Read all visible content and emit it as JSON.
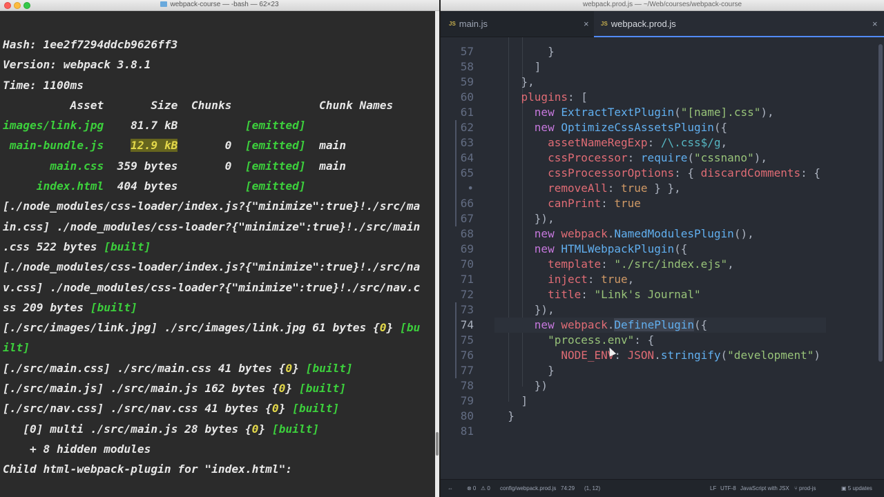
{
  "terminal": {
    "title": "webpack-course — -bash — 62×23",
    "lines": [
      [
        {
          "t": "Hash: 1ee2f7294ddcb9626ff3"
        }
      ],
      [
        {
          "t": "Version: webpack 3.8.1"
        }
      ],
      [
        {
          "t": "Time: 1100ms"
        }
      ],
      [
        {
          "t": "          Asset       Size  Chunks             Chunk Names"
        }
      ],
      [
        {
          "t": "images/link.jpg",
          "c": "g"
        },
        {
          "t": "    81.7 kB          "
        },
        {
          "t": "[emitted]",
          "c": "g"
        }
      ],
      [
        {
          "t": " main-bundle.js",
          "c": "g"
        },
        {
          "t": "    "
        },
        {
          "t": "12.9 kB",
          "c": "hl"
        },
        {
          "t": "       0  "
        },
        {
          "t": "[emitted]",
          "c": "g"
        },
        {
          "t": "  main"
        }
      ],
      [
        {
          "t": "       main.css",
          "c": "g"
        },
        {
          "t": "  359 bytes       0  "
        },
        {
          "t": "[emitted]",
          "c": "g"
        },
        {
          "t": "  main"
        }
      ],
      [
        {
          "t": "     index.html",
          "c": "g"
        },
        {
          "t": "  404 bytes          "
        },
        {
          "t": "[emitted]",
          "c": "g"
        }
      ],
      [
        {
          "t": "[./node_modules/css-loader/index.js?{\"minimize\":true}!./src/ma"
        }
      ],
      [
        {
          "t": "in.css] ./node_modules/css-loader?{\"minimize\":true}!./src/main"
        }
      ],
      [
        {
          "t": ".css 522 bytes "
        },
        {
          "t": "[built]",
          "c": "g"
        }
      ],
      [
        {
          "t": "[./node_modules/css-loader/index.js?{\"minimize\":true}!./src/na"
        }
      ],
      [
        {
          "t": "v.css] ./node_modules/css-loader?{\"minimize\":true}!./src/nav.c"
        }
      ],
      [
        {
          "t": "ss 209 bytes "
        },
        {
          "t": "[built]",
          "c": "g"
        }
      ],
      [
        {
          "t": "[./src/images/link.jpg] ./src/images/link.jpg 61 bytes {"
        },
        {
          "t": "0",
          "c": "y"
        },
        {
          "t": "} "
        },
        {
          "t": "[bu",
          "c": "g"
        }
      ],
      [
        {
          "t": "ilt]",
          "c": "g"
        }
      ],
      [
        {
          "t": "[./src/main.css] ./src/main.css 41 bytes {"
        },
        {
          "t": "0",
          "c": "y"
        },
        {
          "t": "} "
        },
        {
          "t": "[built]",
          "c": "g"
        }
      ],
      [
        {
          "t": "[./src/main.js] ./src/main.js 162 bytes {"
        },
        {
          "t": "0",
          "c": "y"
        },
        {
          "t": "} "
        },
        {
          "t": "[built]",
          "c": "g"
        }
      ],
      [
        {
          "t": "[./src/nav.css] ./src/nav.css 41 bytes {"
        },
        {
          "t": "0",
          "c": "y"
        },
        {
          "t": "} "
        },
        {
          "t": "[built]",
          "c": "g"
        }
      ],
      [
        {
          "t": "   [0] multi ./src/main.js 28 bytes {"
        },
        {
          "t": "0",
          "c": "y"
        },
        {
          "t": "} "
        },
        {
          "t": "[built]",
          "c": "g"
        }
      ],
      [
        {
          "t": "    + 8 hidden modules"
        }
      ],
      [
        {
          "t": "Child html-webpack-plugin for \"index.html\":"
        }
      ]
    ]
  },
  "editor": {
    "title": "webpack.prod.js — ~/Web/courses/webpack-course",
    "tabs": [
      {
        "label": "main.js",
        "badge": "JS",
        "close": "×"
      },
      {
        "label": "webpack.prod.js",
        "badge": "JS",
        "close": "×",
        "active": true
      }
    ],
    "line_numbers": [
      "57",
      "58",
      "59",
      "60",
      "61",
      "62",
      "63",
      "64",
      "65",
      "•",
      "66",
      "67",
      "68",
      "69",
      "70",
      "71",
      "72",
      "73",
      "74",
      "75",
      "76",
      "77",
      "78",
      "79",
      "80",
      "81"
    ],
    "code_lines": [
      [
        {
          "t": "        }"
        }
      ],
      [
        {
          "t": "      ]"
        }
      ],
      [
        {
          "t": "    },"
        }
      ],
      [
        {
          "t": "    "
        },
        {
          "t": "plugins",
          "c": "p"
        },
        {
          "t": ": ["
        }
      ],
      [
        {
          "t": "      "
        },
        {
          "t": "new",
          "c": "k"
        },
        {
          "t": " "
        },
        {
          "t": "ExtractTextPlugin",
          "c": "f"
        },
        {
          "t": "("
        },
        {
          "t": "\"[name].css\"",
          "c": "s"
        },
        {
          "t": "),"
        }
      ],
      [
        {
          "t": "      "
        },
        {
          "t": "new",
          "c": "k"
        },
        {
          "t": " "
        },
        {
          "t": "OptimizeCssAssetsPlugin",
          "c": "f"
        },
        {
          "t": "({"
        }
      ],
      [
        {
          "t": "        "
        },
        {
          "t": "assetNameRegExp",
          "c": "p"
        },
        {
          "t": ": "
        },
        {
          "t": "/\\.css$/g",
          "c": "c"
        },
        {
          "t": ","
        }
      ],
      [
        {
          "t": "        "
        },
        {
          "t": "cssProcessor",
          "c": "p"
        },
        {
          "t": ": "
        },
        {
          "t": "require",
          "c": "f"
        },
        {
          "t": "("
        },
        {
          "t": "\"cssnano\"",
          "c": "s"
        },
        {
          "t": "),"
        }
      ],
      [
        {
          "t": "        "
        },
        {
          "t": "cssProcessorOptions",
          "c": "p"
        },
        {
          "t": ": { "
        },
        {
          "t": "discardComments",
          "c": "p"
        },
        {
          "t": ": {"
        }
      ],
      [
        {
          "t": "        "
        },
        {
          "t": "removeAll",
          "c": "p"
        },
        {
          "t": ": "
        },
        {
          "t": "true",
          "c": "o"
        },
        {
          "t": " } },"
        }
      ],
      [
        {
          "t": "        "
        },
        {
          "t": "canPrint",
          "c": "p"
        },
        {
          "t": ": "
        },
        {
          "t": "true",
          "c": "o"
        }
      ],
      [
        {
          "t": "      }),"
        }
      ],
      [
        {
          "t": "      "
        },
        {
          "t": "new",
          "c": "k"
        },
        {
          "t": " "
        },
        {
          "t": "webpack",
          "c": "p"
        },
        {
          "t": "."
        },
        {
          "t": "NamedModulesPlugin",
          "c": "f"
        },
        {
          "t": "(),"
        }
      ],
      [
        {
          "t": "      "
        },
        {
          "t": "new",
          "c": "k"
        },
        {
          "t": " "
        },
        {
          "t": "HTMLWebpackPlugin",
          "c": "f"
        },
        {
          "t": "({"
        }
      ],
      [
        {
          "t": "        "
        },
        {
          "t": "template",
          "c": "p"
        },
        {
          "t": ": "
        },
        {
          "t": "\"./src/index.ejs\"",
          "c": "s"
        },
        {
          "t": ","
        }
      ],
      [
        {
          "t": "        "
        },
        {
          "t": "inject",
          "c": "p"
        },
        {
          "t": ": "
        },
        {
          "t": "true",
          "c": "o"
        },
        {
          "t": ","
        }
      ],
      [
        {
          "t": "        "
        },
        {
          "t": "title",
          "c": "p"
        },
        {
          "t": ": "
        },
        {
          "t": "\"Link's Journal\"",
          "c": "s"
        }
      ],
      [
        {
          "t": "      }),"
        }
      ],
      [
        {
          "t": "      "
        },
        {
          "t": "new",
          "c": "k"
        },
        {
          "t": " "
        },
        {
          "t": "webpack",
          "c": "p"
        },
        {
          "t": "."
        },
        {
          "t": "DefinePlugin",
          "c": "f sel"
        },
        {
          "t": "({"
        }
      ],
      [
        {
          "t": "        "
        },
        {
          "t": "\"process.env\"",
          "c": "s"
        },
        {
          "t": ": {"
        }
      ],
      [
        {
          "t": "          "
        },
        {
          "t": "NODE_ENV",
          "c": "p"
        },
        {
          "t": ": "
        },
        {
          "t": "JSON",
          "c": "p"
        },
        {
          "t": "."
        },
        {
          "t": "stringify",
          "c": "f"
        },
        {
          "t": "("
        },
        {
          "t": "\"development\"",
          "c": "s"
        },
        {
          "t": ")"
        }
      ],
      [
        {
          "t": "        }"
        }
      ],
      [
        {
          "t": "      })"
        }
      ],
      [
        {
          "t": "    ]"
        }
      ],
      [
        {
          "t": "  }"
        }
      ],
      [
        {
          "t": ""
        }
      ]
    ],
    "status": {
      "errors": "⊗ 0",
      "warnings": "⚠ 0",
      "file": "config/webpack.prod.js",
      "cursor": "74:29",
      "selection": "(1, 12)",
      "eol": "LF",
      "encoding": "UTF-8",
      "grammar": "JavaScript with JSX",
      "branch": "prod-js",
      "updates": "5 updates"
    }
  }
}
